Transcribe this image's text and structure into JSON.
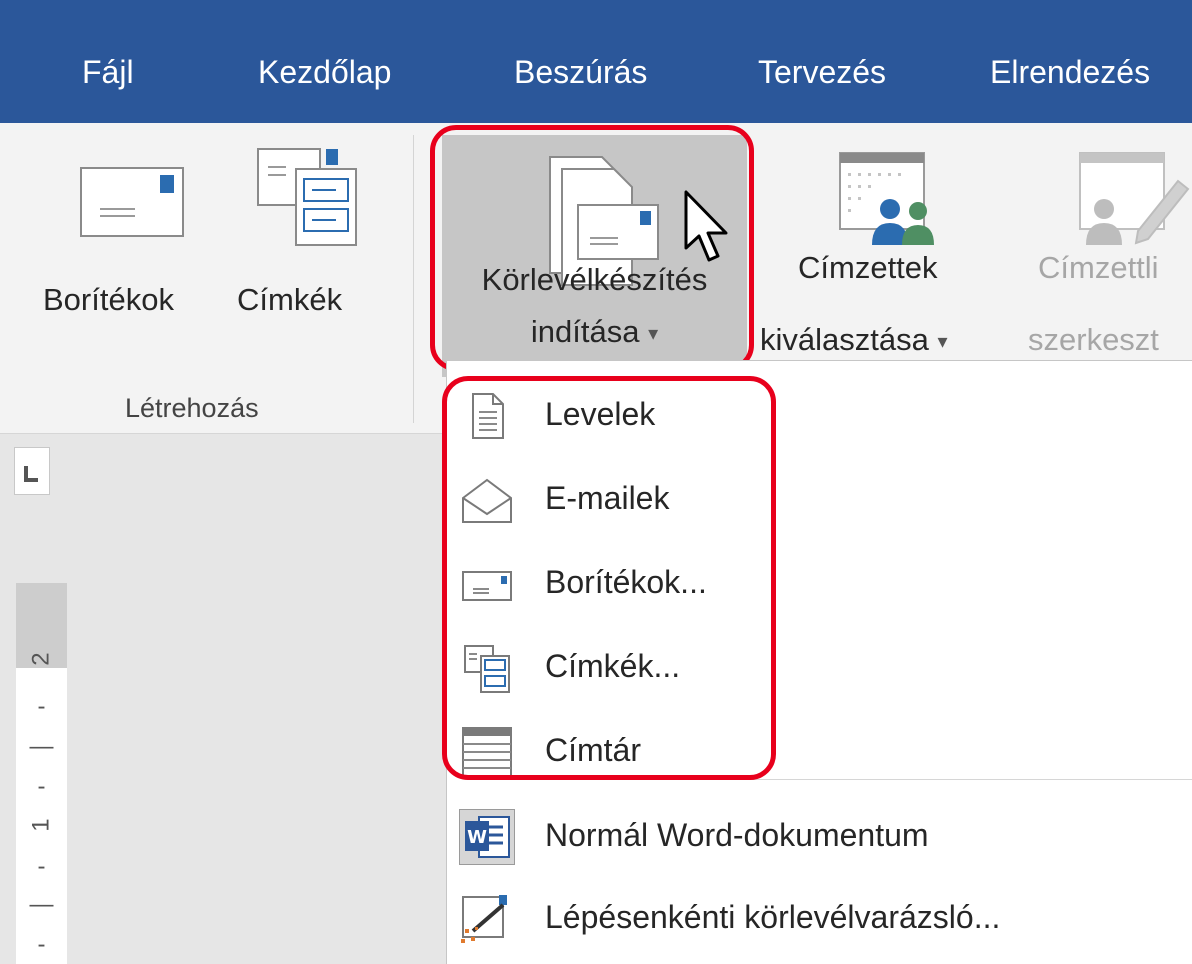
{
  "menu": {
    "tabs": [
      "Fájl",
      "Kezdőlap",
      "Beszúrás",
      "Tervezés",
      "Elrendezés"
    ]
  },
  "ribbon": {
    "envelopes_label": "Borítékok",
    "labels_label": "Címkék",
    "group_create": "Létrehozás",
    "start_mail_merge": {
      "line1": "Körlevélkészítés",
      "line2": "indítása"
    },
    "select_recipients": {
      "line1": "Címzettek",
      "line2": "kiválasztása"
    },
    "edit_recipients": {
      "line1": "Címzettli",
      "line2": "szerkeszt"
    }
  },
  "ruler": {
    "marks": [
      "2",
      "1"
    ]
  },
  "dropdown": {
    "items": [
      {
        "label": "Levelek",
        "icon": "document-icon"
      },
      {
        "label": "E-mailek",
        "icon": "open-envelope-icon"
      },
      {
        "label": "Borítékok...",
        "icon": "envelope-icon"
      },
      {
        "label": "Címkék...",
        "icon": "labels-icon"
      },
      {
        "label": "Címtár",
        "icon": "directory-icon"
      },
      {
        "label": "Normál Word-dokumentum",
        "icon": "word-document-icon"
      },
      {
        "label": "Lépésenkénti körlevélvarázsló...",
        "icon": "wizard-icon"
      }
    ]
  },
  "colors": {
    "title_bar": "#2b579a",
    "highlight": "#e8001c",
    "ribbon": "#f3f3f3",
    "hover_button": "#c6c6c6"
  }
}
